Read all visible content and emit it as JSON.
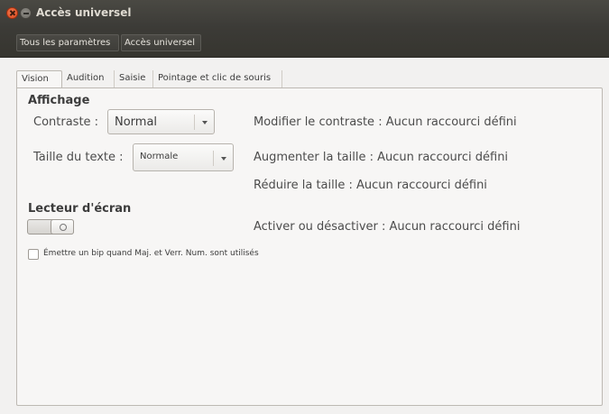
{
  "window": {
    "title": "Accès universel"
  },
  "breadcrumbs": [
    "Tous les paramètres",
    "Accès universel"
  ],
  "tabs": [
    "Vision",
    "Audition",
    "Saisie",
    "Pointage et clic de souris"
  ],
  "vision": {
    "display_heading": "Affichage",
    "contrast_label": "Contraste :",
    "contrast_value": "Normal",
    "text_size_label": "Taille du texte :",
    "text_size_value": "Normale",
    "shortcuts": [
      "Modifier le contraste : Aucun raccourci défini",
      "Augmenter la taille : Aucun raccourci défini",
      "Réduire la taille : Aucun raccourci défini",
      "Activer ou désactiver : Aucun raccourci défini"
    ],
    "screen_reader_heading": "Lecteur d'écran",
    "screen_reader_enabled": false,
    "beep_label": "Émettre un bip quand Maj. et Verr. Num. sont utilisés",
    "beep_checked": false
  }
}
